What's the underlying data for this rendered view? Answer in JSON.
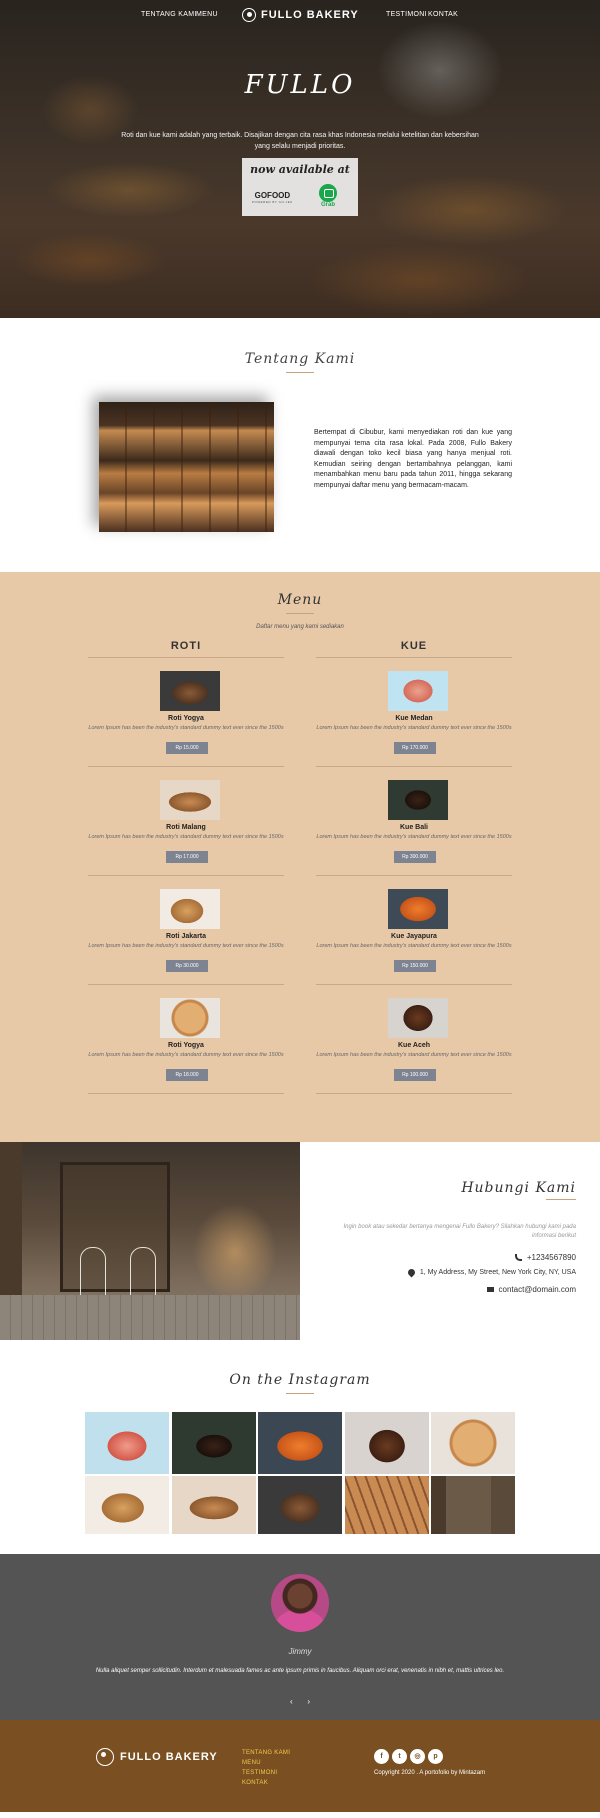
{
  "nav": {
    "tentang": "TENTANG KAMI",
    "menu": "MENU",
    "brand": "FULLO BAKERY",
    "testimoni": "TESTIMONI",
    "kontak": "KONTAK"
  },
  "hero": {
    "title": "FULLO",
    "text": "Roti dan kue kami adalah yang terbaik. Disajikan dengan cita rasa khas Indonesia melalui ketelitian dan kebersihan yang selalu menjadi prioritas.",
    "available": "now available at",
    "gofood": "GOFOOD",
    "gofood_sub": "POWERED BY GO-JEK",
    "grab": "Grab"
  },
  "about": {
    "title": "Tentang Kami",
    "text": "Bertempat di Cibubur, kami menyediakan roti dan kue yang mempunyai tema cita rasa lokal. Pada 2008, Fullo Bakery diawali dengan toko kecil biasa yang hanya menjual roti. Kemudian seiring dengan bertambahnya pelanggan, kami menambahkan menu baru pada tahun 2011, hingga sekarang mempunyai daftar menu yang bermacam-macam."
  },
  "menu": {
    "title": "Menu",
    "subtitle": "Daftar menu yang kami sediakan",
    "roti": {
      "heading": "ROTI",
      "items": [
        {
          "name": "Roti Yogya",
          "desc": "Lorem Ipsum has been the industry's standard dummy text ever since the 1500s",
          "price": "Rp 15.000"
        },
        {
          "name": "Roti Malang",
          "desc": "Lorem Ipsum has been the industry's standard dummy text ever since the 1500s",
          "price": "Rp 17.000"
        },
        {
          "name": "Roti Jakarta",
          "desc": "Lorem Ipsum has been the industry's standard dummy text ever since the 1500s",
          "price": "Rp 30.000"
        },
        {
          "name": "Roti Yogya",
          "desc": "Lorem Ipsum has been the industry's standard dummy text ever since the 1500s",
          "price": "Rp 18.000"
        }
      ]
    },
    "kue": {
      "heading": "KUE",
      "items": [
        {
          "name": "Kue Medan",
          "desc": "Lorem Ipsum has been the industry's standard dummy text ever since the 1500s",
          "price": "Rp 170.000"
        },
        {
          "name": "Kue Bali",
          "desc": "Lorem Ipsum has been the industry's standard dummy text ever since the 1500s",
          "price": "Rp 300.000"
        },
        {
          "name": "Kue Jayapura",
          "desc": "Lorem Ipsum has been the industry's standard dummy text ever since the 1500s",
          "price": "Rp 150.000"
        },
        {
          "name": "Kue Aceh",
          "desc": "Lorem Ipsum has been the industry's standard dummy text ever since the 1500s",
          "price": "Rp 100.000"
        }
      ]
    }
  },
  "contact": {
    "title": "Hubungi Kami",
    "text": "Ingin book atau sekedar bertanya mengenai Fullo Bakery? Silahkan hubungi kami pada informasi berikut",
    "phone": "+1234567890",
    "address": "1, My Address, My Street, New York City, NY, USA",
    "email": "contact@domain.com"
  },
  "instagram": {
    "title": "On the Instagram"
  },
  "testimonial": {
    "name": "Jimmy",
    "quote": "Nulla aliquet semper sollicitudin. Interdum et malesuada fames ac ante ipsum primis in faucibus. Aliquam orci erat, venenatis in nibh et, mattis ultrices leo.",
    "prev": "‹",
    "next": "›"
  },
  "footer": {
    "brand": "FULLO BAKERY",
    "links": [
      "TENTANG KAMI",
      "MENU",
      "TESTIMONI",
      "KONTAK"
    ],
    "socials": [
      "f",
      "t",
      "◎",
      "p"
    ],
    "copyright": "Copyright 2020 . A portofolio by Mintazam"
  },
  "colors": {
    "menu_bg": "#e7c9a8",
    "footer_bg": "#7a5022",
    "testimonial_bg": "#545454",
    "footer_link": "#f2c94c",
    "price_badge": "#7d8390"
  }
}
